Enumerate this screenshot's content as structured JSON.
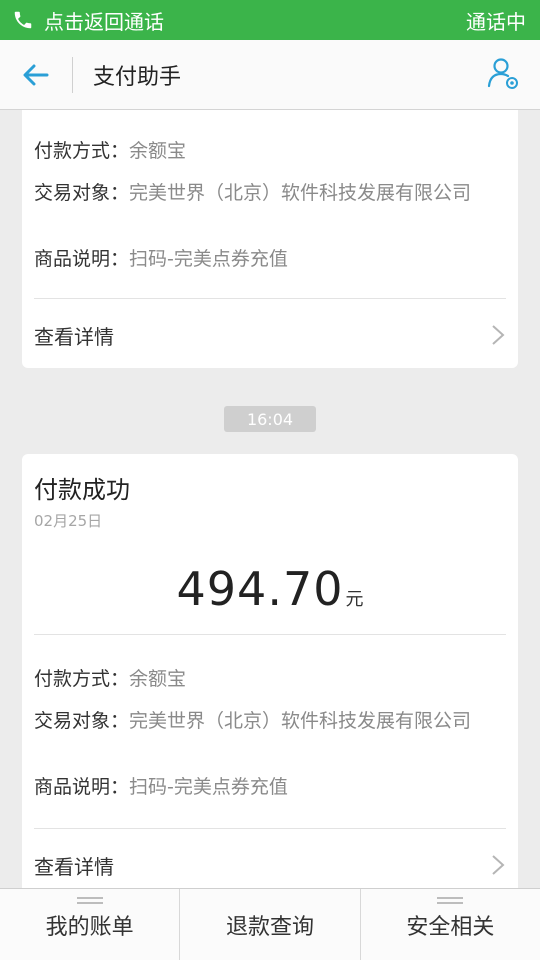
{
  "call_bar": {
    "left_text": "点击返回通话",
    "right_text": "通话中",
    "icon": "phone-icon"
  },
  "header": {
    "title": "支付助手",
    "back_icon": "arrow-left-icon",
    "profile_icon": "user-settings-icon"
  },
  "cards": [
    {
      "rows": [
        {
          "key": "付款方式：",
          "value": "余额宝"
        },
        {
          "key": "交易对象：",
          "value": "完美世界（北京）软件科技发展有限公司"
        },
        {
          "key": "商品说明：",
          "value": "扫码-完美点券充值"
        }
      ],
      "detail_label": "查看详情"
    },
    {
      "status": "付款成功",
      "date": "02月25日",
      "amount": "494.70",
      "currency": "元",
      "rows": [
        {
          "key": "付款方式：",
          "value": "余额宝"
        },
        {
          "key": "交易对象：",
          "value": "完美世界（北京）软件科技发展有限公司"
        },
        {
          "key": "商品说明：",
          "value": "扫码-完美点券充值"
        }
      ],
      "detail_label": "查看详情"
    }
  ],
  "time_badge": "16:04",
  "tabs": [
    {
      "label": "我的账单"
    },
    {
      "label": "退款查询"
    },
    {
      "label": "安全相关"
    }
  ],
  "colors": {
    "call_bar": "#3bb44a",
    "accent": "#2a9fd6",
    "background": "#ececec"
  }
}
